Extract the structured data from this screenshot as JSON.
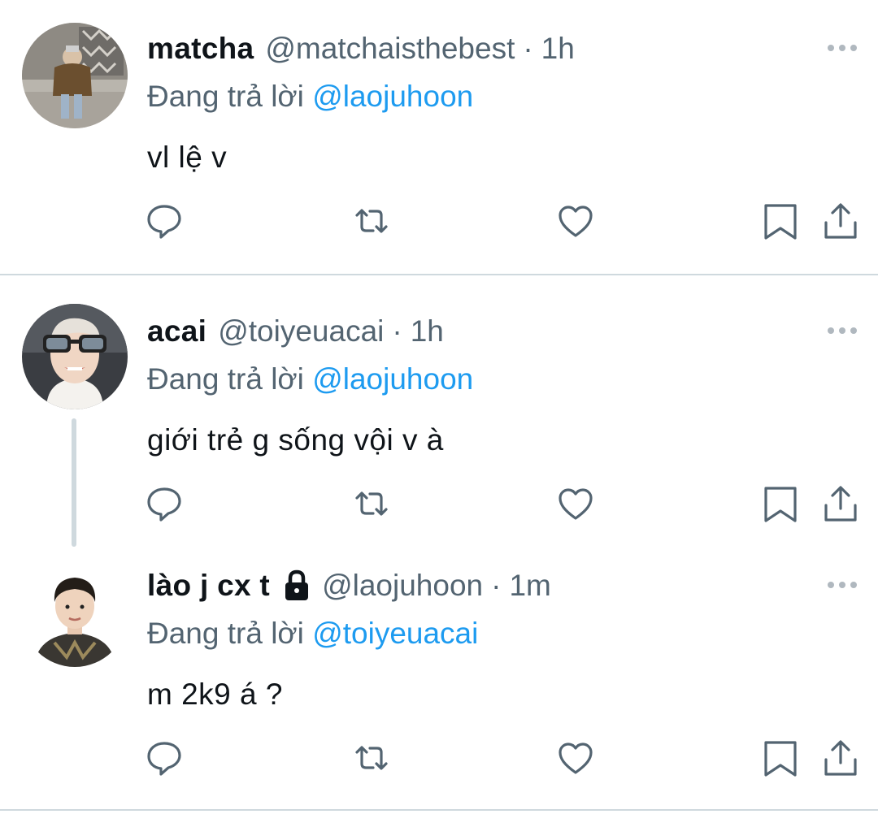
{
  "tweets": [
    {
      "name": "matcha",
      "handle": "@matchaisthebest",
      "dot": "·",
      "time": "1h",
      "reply_prefix": "Đang trả lời",
      "reply_to": "@laojuhoon",
      "text": "vl lệ v",
      "locked": false
    },
    {
      "name": "acai",
      "handle": "@toiyeuacai",
      "dot": "·",
      "time": "1h",
      "reply_prefix": "Đang trả lời",
      "reply_to": "@laojuhoon",
      "text": "giới trẻ g sống vội v à",
      "locked": false
    },
    {
      "name": "lào j cx t",
      "handle": "@laojuhoon",
      "dot": "·",
      "time": "1m",
      "reply_prefix": "Đang trả lời",
      "reply_to": "@toiyeuacai",
      "text": "m 2k9 á ?",
      "locked": true
    }
  ],
  "icons": {
    "reply": "speech-bubble",
    "retweet": "retweet-arrows",
    "like": "heart",
    "bookmark": "bookmark",
    "share": "share-upload",
    "more": "ellipsis",
    "lock": "padlock"
  },
  "colors": {
    "text": "#0f1419",
    "secondary": "#536471",
    "mention": "#1d9bf0",
    "divider": "#cfd9de"
  }
}
